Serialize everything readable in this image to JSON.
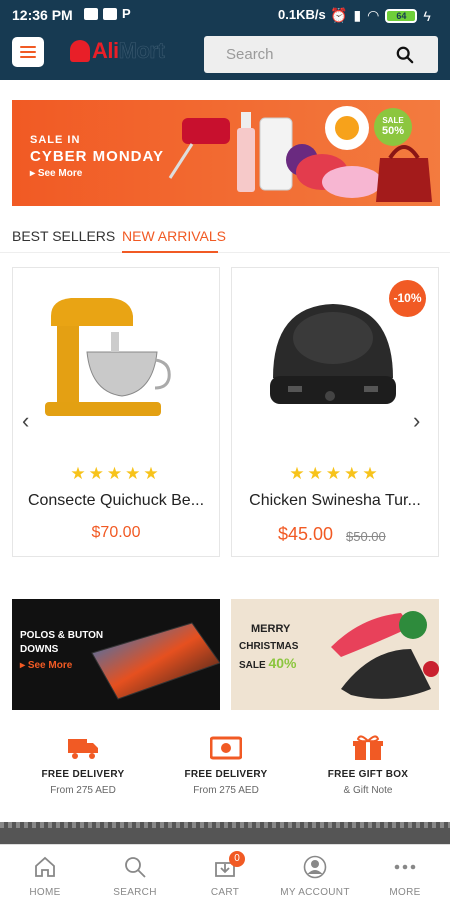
{
  "status_bar": {
    "time": "12:36 PM",
    "network_speed": "0.1KB/s",
    "battery": "64"
  },
  "header": {
    "logo_part1": "Ali",
    "logo_part2": "Mort",
    "search_placeholder": "Search",
    "menu_icon": "hamburger-icon",
    "search_icon": "search-icon"
  },
  "banner": {
    "line1": "SALE IN",
    "line2": "CYBER MONDAY",
    "link": "See More",
    "badge_top": "SALE",
    "badge_value": "50%"
  },
  "tabs": [
    {
      "label": "BEST SELLERS",
      "active": false
    },
    {
      "label": "NEW ARRIVALS",
      "active": true
    }
  ],
  "products": [
    {
      "name": "Consecte Quichuck Be...",
      "price": "$70.00",
      "old_price": "",
      "rating": 5,
      "discount": ""
    },
    {
      "name": "Chicken Swinesha Tur...",
      "price": "$45.00",
      "old_price": "$50.00",
      "rating": 5,
      "discount": "-10%"
    }
  ],
  "promos": [
    {
      "title": "POLOS & BUTON DOWNS",
      "link": "See More"
    },
    {
      "title": "MERRY",
      "subtitle": "CHRISTMAS",
      "sale": "SALE",
      "sale_value": "40%"
    }
  ],
  "features": [
    {
      "title": "FREE DELIVERY",
      "subtitle": "From 275 AED",
      "icon": "truck-icon"
    },
    {
      "title": "FREE DELIVERY",
      "subtitle": "From 275 AED",
      "icon": "money-icon"
    },
    {
      "title": "FREE GIFT BOX",
      "subtitle": "& Gift Note",
      "icon": "gift-icon"
    }
  ],
  "bottom_nav": [
    {
      "label": "HOME",
      "icon": "home-icon"
    },
    {
      "label": "SEARCH",
      "icon": "search-icon"
    },
    {
      "label": "CART",
      "icon": "cart-icon",
      "badge": "0"
    },
    {
      "label": "MY ACCOUNT",
      "icon": "account-icon"
    },
    {
      "label": "MORE",
      "icon": "more-icon"
    }
  ],
  "colors": {
    "header_bg": "#173a52",
    "accent": "#f15a24",
    "star": "#f7c31b",
    "sale_green": "#8cc63f"
  }
}
